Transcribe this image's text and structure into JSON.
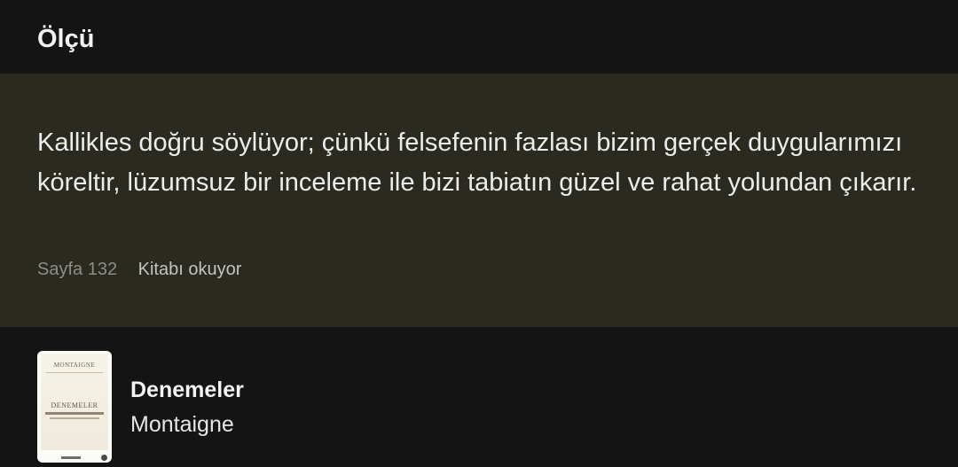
{
  "header": {
    "title": "Ölçü"
  },
  "quote": {
    "text": "Kallikles doğru söylüyor; çünkü felsefenin fazlası bizim gerçek duygularımızı köreltir, lüzumsuz bir inceleme ile bizi tabiatın güzel ve rahat yolundan çıkarır.",
    "page_ref": "Sayfa 132",
    "reading_label": "Kitabı okuyor"
  },
  "book": {
    "title": "Denemeler",
    "author": "Montaigne",
    "cover": {
      "author_text": "MONTAIGNE",
      "title_text": "DENEMELER"
    }
  },
  "colors": {
    "background": "#141414",
    "card_background": "#2b2a20",
    "primary_text": "#f2f2f2",
    "secondary_text": "#8e8e88"
  }
}
